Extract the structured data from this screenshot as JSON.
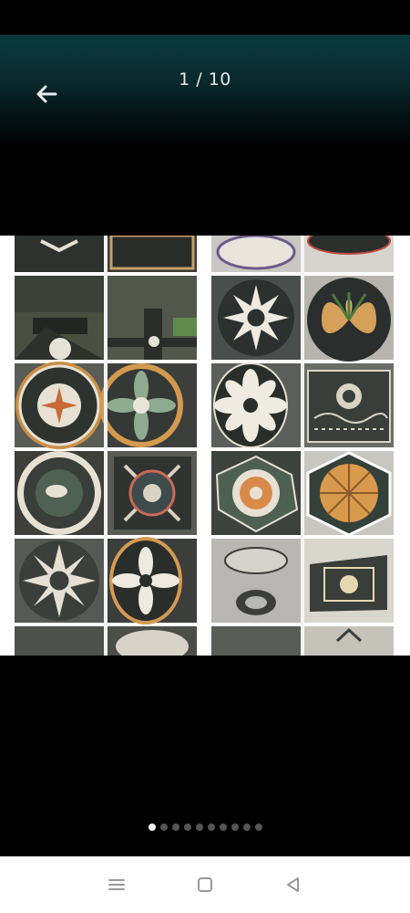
{
  "header": {
    "counter_text": "1 / 10"
  },
  "icons": {
    "back": "arrow-left-icon",
    "menu": "menu-icon",
    "home": "home-square-icon",
    "back_nav": "triangle-back-icon"
  },
  "image": {
    "description_colors": {
      "mosaic_dark": "#3b3f3c",
      "mosaic_cream": "#e8e3d6",
      "mosaic_orange": "#d89a4a",
      "mosaic_green": "#4e6a55"
    }
  },
  "pager": {
    "total": 10,
    "active_index": 0
  },
  "colors": {
    "header_teal": "#0c3a3f",
    "background": "#000000",
    "navbar": "#ffffff",
    "dot_active": "#f5f5f5",
    "dot_inactive": "#555555"
  }
}
